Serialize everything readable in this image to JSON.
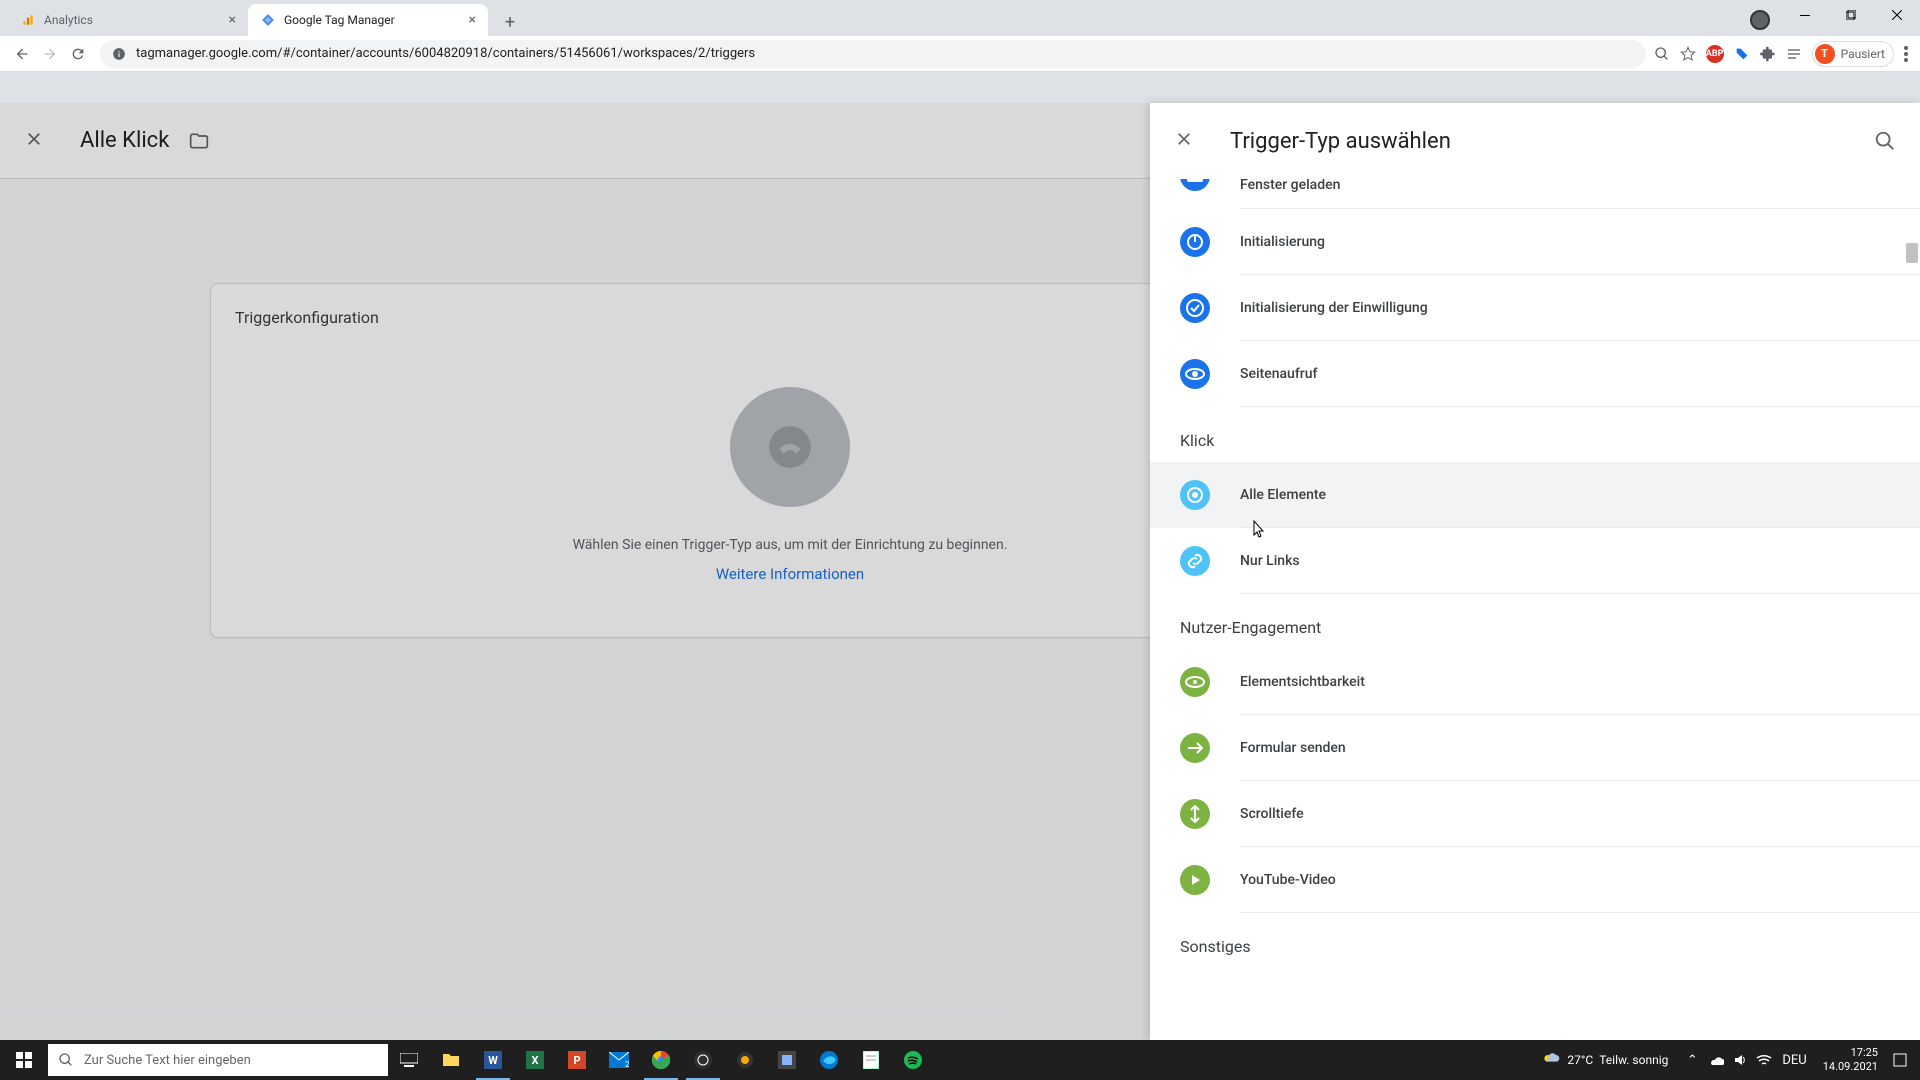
{
  "browser": {
    "tabs": [
      {
        "title": "Analytics",
        "favicon_color": "#f9ab00"
      },
      {
        "title": "Google Tag Manager",
        "favicon_color": "#4285f4"
      }
    ],
    "url": "tagmanager.google.com/#/container/accounts/6004820918/containers/51456061/workspaces/2/triggers",
    "paused_label": "Pausiert",
    "paused_initial": "T"
  },
  "gtm": {
    "trigger_name": "Alle Klick",
    "config_section_title": "Triggerkonfiguration",
    "empty_text": "Wählen Sie einen Trigger-Typ aus, um mit der Einrichtung zu beginnen.",
    "more_info": "Weitere Informationen"
  },
  "panel": {
    "title": "Trigger-Typ auswählen",
    "sections": [
      {
        "items": [
          {
            "label": "Fenster geladen",
            "icon": "window-loaded",
            "color": "#1a73e8"
          },
          {
            "label": "Initialisierung",
            "icon": "power",
            "color": "#1a73e8"
          },
          {
            "label": "Initialisierung der Einwilligung",
            "icon": "consent",
            "color": "#1a73e8"
          },
          {
            "label": "Seitenaufruf",
            "icon": "pageview",
            "color": "#1a73e8"
          }
        ]
      },
      {
        "header": "Klick",
        "items": [
          {
            "label": "Alle Elemente",
            "icon": "click-all",
            "color": "#4fc3f7",
            "hovered": true
          },
          {
            "label": "Nur Links",
            "icon": "link",
            "color": "#4fc3f7"
          }
        ]
      },
      {
        "header": "Nutzer-Engagement",
        "items": [
          {
            "label": "Elementsichtbarkeit",
            "icon": "visibility",
            "color": "#7cb342"
          },
          {
            "label": "Formular senden",
            "icon": "form",
            "color": "#7cb342"
          },
          {
            "label": "Scrolltiefe",
            "icon": "scroll",
            "color": "#7cb342"
          },
          {
            "label": "YouTube-Video",
            "icon": "video",
            "color": "#7cb342"
          }
        ]
      },
      {
        "header": "Sonstiges",
        "items": []
      }
    ]
  },
  "taskbar": {
    "search_placeholder": "Zur Suche Text hier eingeben",
    "weather_temp": "27°C",
    "weather_desc": "Teilw. sonnig",
    "lang": "DEU",
    "time": "17:25",
    "date": "14.09.2021"
  }
}
